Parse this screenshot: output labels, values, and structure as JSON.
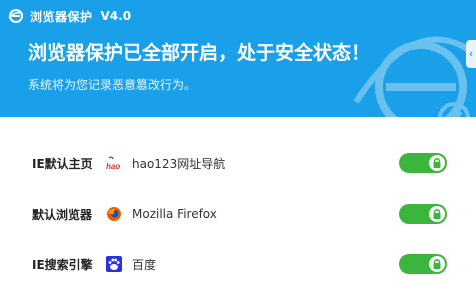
{
  "header": {
    "app_title": "浏览器保护",
    "version": "V4.0",
    "headline": "浏览器保护已全部开启，处于安全状态！",
    "subtitle": "系统将为您记录恶意篡改行为。",
    "edge_tab_glyph": "‹"
  },
  "rows": [
    {
      "label": "IE默认主页",
      "value": "hao123网址导航",
      "icon": "hao123-icon",
      "toggle_on": true,
      "locked": true
    },
    {
      "label": "默认浏览器",
      "value": "Mozilla Firefox",
      "icon": "firefox-icon",
      "toggle_on": true,
      "locked": true
    },
    {
      "label": "IE搜索引擎",
      "value": "百度",
      "icon": "baidu-icon",
      "toggle_on": true,
      "locked": true
    }
  ],
  "colors": {
    "header_bg": "#1aa0e8",
    "toggle_on": "#3cb53c"
  }
}
